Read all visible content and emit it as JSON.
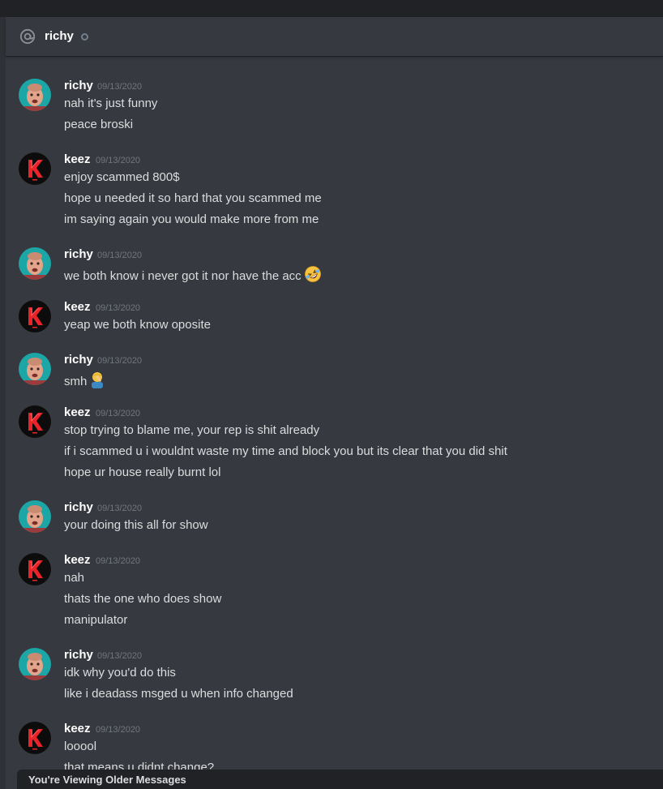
{
  "header": {
    "channel_icon": "at-icon",
    "recipient": "richy",
    "status_icon": "offline-status-icon"
  },
  "older_banner": "You're Viewing Older Messages",
  "colors": {
    "background": "#36393f",
    "titlebar": "#202225",
    "username": "#ffffff",
    "text": "#dcddde",
    "timestamp": "#72767d",
    "keez_avatar_red": "#e8232a",
    "richy_avatar_teal": "#1da6a6"
  },
  "groups": [
    {
      "author": "richy",
      "time": "09/13/2020",
      "lines": [
        "nah it's just funny",
        "peace broski"
      ]
    },
    {
      "author": "keez",
      "time": "09/13/2020",
      "lines": [
        "enjoy scammed 800$",
        "hope u needed it so hard that you scammed me",
        "im saying again you would make more from me"
      ]
    },
    {
      "author": "richy",
      "time": "09/13/2020",
      "lines": [
        "we both know i never got it nor have the acc"
      ],
      "emoji": "rofl-emoji"
    },
    {
      "author": "keez",
      "time": "09/13/2020",
      "lines": [
        "yeap we both know oposite"
      ]
    },
    {
      "author": "richy",
      "time": "09/13/2020",
      "lines": [
        "smh"
      ],
      "emoji": "facepalm-emoji"
    },
    {
      "author": "keez",
      "time": "09/13/2020",
      "lines": [
        "stop trying to blame me, your rep is shit already",
        "if i scammed u i wouldnt waste my time and block you but its clear that you did shit",
        "hope ur house really burnt lol"
      ]
    },
    {
      "author": "richy",
      "time": "09/13/2020",
      "lines": [
        "your doing this all for show"
      ]
    },
    {
      "author": "keez",
      "time": "09/13/2020",
      "lines": [
        "nah",
        "thats the one who does show",
        "manipulator"
      ]
    },
    {
      "author": "richy",
      "time": "09/13/2020",
      "lines": [
        "idk why you'd do this",
        "like i deadass msged u when info changed"
      ]
    },
    {
      "author": "keez",
      "time": "09/13/2020",
      "lines": [
        "looool",
        "that means u didnt change?"
      ]
    }
  ]
}
